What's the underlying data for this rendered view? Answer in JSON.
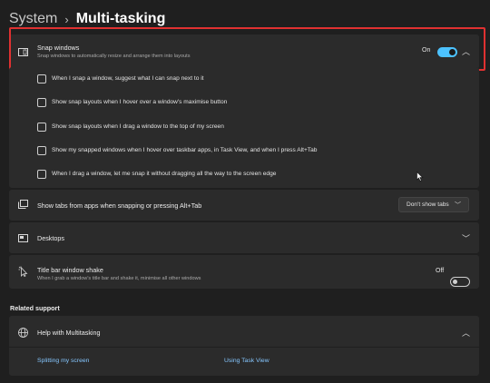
{
  "header": {
    "crumb": "System",
    "separator": "›",
    "current": "Multi-tasking"
  },
  "snap": {
    "title": "Snap windows",
    "subtitle": "Snap windows to automatically resize and arrange them into layouts",
    "state": "On",
    "options": [
      "When I snap a window, suggest what I can snap next to it",
      "Show snap layouts when I hover over a window's maximise button",
      "Show snap layouts when I drag a window to the top of my screen",
      "Show my snapped windows when I hover over taskbar apps, in Task View, and when I press Alt+Tab",
      "When I drag a window, let me snap it without dragging all the way to the screen edge"
    ]
  },
  "tabs": {
    "label": "Show tabs from apps when snapping or pressing Alt+Tab",
    "selected": "Don't show tabs"
  },
  "desktops": {
    "label": "Desktops"
  },
  "shake": {
    "title": "Title bar window shake",
    "subtitle": "When I grab a window's title bar and shake it, minimise all other windows",
    "state": "Off"
  },
  "related": {
    "heading": "Related support",
    "help_title": "Help with Multitasking",
    "links": [
      "Splitting my screen",
      "Using Task View"
    ]
  },
  "colors": {
    "accent": "#4cc2ff",
    "highlight": "#e03131",
    "link": "#86c7ff"
  }
}
